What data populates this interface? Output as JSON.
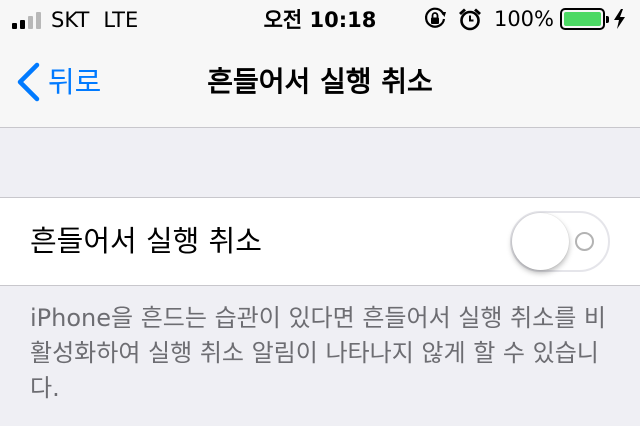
{
  "status_bar": {
    "carrier": "SKT",
    "network": "LTE",
    "time": "오전 10:18",
    "battery_percent": "100%",
    "battery_level": 1.0,
    "signal_bars_filled": 2,
    "signal_bars_total": 4,
    "icons": [
      "orientation-lock-icon",
      "alarm-icon",
      "charging-bolt-icon"
    ],
    "battery_color": "#4cd964"
  },
  "nav": {
    "back_label": "뒤로",
    "title": "흔들어서 실행 취소",
    "accent_color": "#007aff"
  },
  "setting": {
    "label": "흔들어서 실행 취소",
    "toggle_on": false
  },
  "footer": {
    "description": "iPhone을 흔드는 습관이 있다면 흔들어서 실행 취소를 비활성화하여 실행 취소 알림이 나타나지 않게 할 수 있습니다."
  }
}
